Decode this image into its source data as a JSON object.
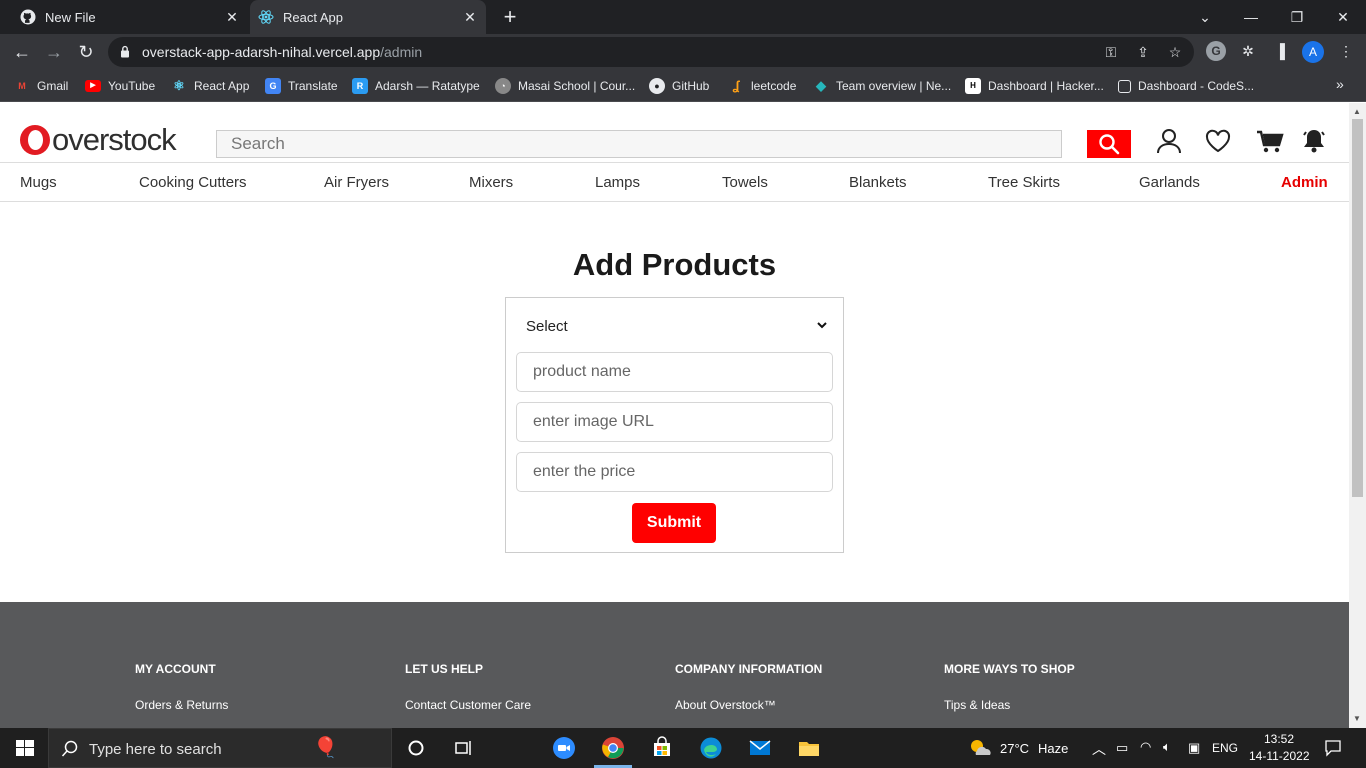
{
  "browser": {
    "tabs": [
      {
        "title": "New File",
        "icon": "github-icon"
      },
      {
        "title": "React App",
        "icon": "react-icon",
        "active": true
      }
    ],
    "url_host": "overstack-app-adarsh-nihal.vercel.app",
    "url_path": "/admin",
    "profile_initial": "A",
    "bookmarks": [
      {
        "label": "Gmail",
        "icon": "gmail-icon"
      },
      {
        "label": "YouTube",
        "icon": "youtube-icon"
      },
      {
        "label": "React App",
        "icon": "react-icon"
      },
      {
        "label": "Translate",
        "icon": "translate-icon"
      },
      {
        "label": "Adarsh — Ratatype",
        "icon": "ratatype-icon"
      },
      {
        "label": "Masai School | Cour...",
        "icon": "masai-icon"
      },
      {
        "label": "GitHub",
        "icon": "github-icon"
      },
      {
        "label": "leetcode",
        "icon": "leetcode-icon"
      },
      {
        "label": "Team overview | Ne...",
        "icon": "diamond-icon"
      },
      {
        "label": "Dashboard | Hacker...",
        "icon": "hackerrank-icon"
      },
      {
        "label": "Dashboard - CodeS...",
        "icon": "page-icon"
      }
    ]
  },
  "site": {
    "logo_text": "overstock",
    "search_placeholder": "Search",
    "categories": [
      "Mugs",
      "Cooking Cutters",
      "Air Fryers",
      "Mixers",
      "Lamps",
      "Towels",
      "Blankets",
      "Tree Skirts",
      "Garlands"
    ],
    "admin_label": "Admin",
    "accent_color": "#ff0000"
  },
  "form": {
    "title": "Add Products",
    "select_value": "Select",
    "product_name_placeholder": "product name",
    "image_url_placeholder": "enter image URL",
    "price_placeholder": "enter the price",
    "submit_label": "Submit"
  },
  "footer": {
    "columns": [
      {
        "heading": "MY ACCOUNT",
        "link": "Orders & Returns"
      },
      {
        "heading": "LET US HELP",
        "link": "Contact Customer Care"
      },
      {
        "heading": "COMPANY INFORMATION",
        "link": "About Overstock™"
      },
      {
        "heading": "MORE WAYS TO SHOP",
        "link": "Tips & Ideas"
      }
    ]
  },
  "taskbar": {
    "search_placeholder": "Type here to search",
    "weather_temp": "27°C",
    "weather_text": "Haze",
    "language": "ENG",
    "time": "13:52",
    "date": "14-11-2022"
  }
}
